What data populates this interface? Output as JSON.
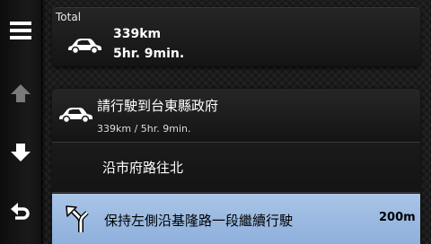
{
  "total": {
    "label": "Total",
    "distance": "339km",
    "time": "5hr. 9min."
  },
  "rows": [
    {
      "icon": "car-icon",
      "title": "請行駛到台東縣政府",
      "subtitle": "339km / 5hr. 9min."
    },
    {
      "title": "沿市府路往北"
    },
    {
      "icon": "keep-left-arrow-icon",
      "title": "保持左側沿基隆路一段繼續行駛",
      "distance": "200m",
      "selected": true
    }
  ],
  "rail": {
    "items": [
      "menu-icon",
      "scroll-up-icon",
      "scroll-down-icon",
      "back-icon"
    ]
  },
  "colors": {
    "selected_row": "#9dbbe2",
    "panel": "#1c1c1c",
    "text": "#ffffff"
  }
}
